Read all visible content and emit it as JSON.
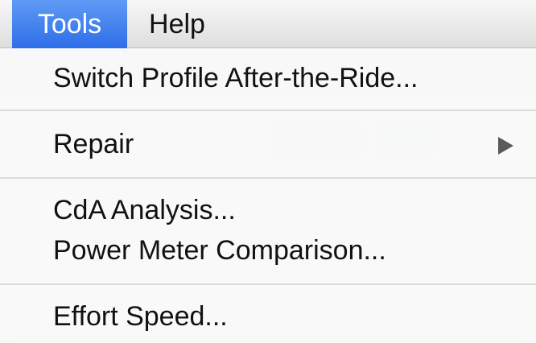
{
  "menubar": {
    "items": [
      {
        "label": "Tools",
        "active": true
      },
      {
        "label": "Help",
        "active": false
      }
    ]
  },
  "menu": {
    "items": [
      {
        "label": "Switch Profile After-the-Ride...",
        "has_submenu": false
      },
      {
        "label": "Repair",
        "has_submenu": true
      },
      {
        "label": "CdA Analysis...",
        "has_submenu": false
      },
      {
        "label": "Power Meter Comparison...",
        "has_submenu": false
      },
      {
        "label": "Effort Speed...",
        "has_submenu": false
      }
    ],
    "arrow_icon": "chevron-right-icon"
  },
  "colors": {
    "highlight": "#3a7bea",
    "separator": "#dcdcdc",
    "text": "#111111"
  }
}
